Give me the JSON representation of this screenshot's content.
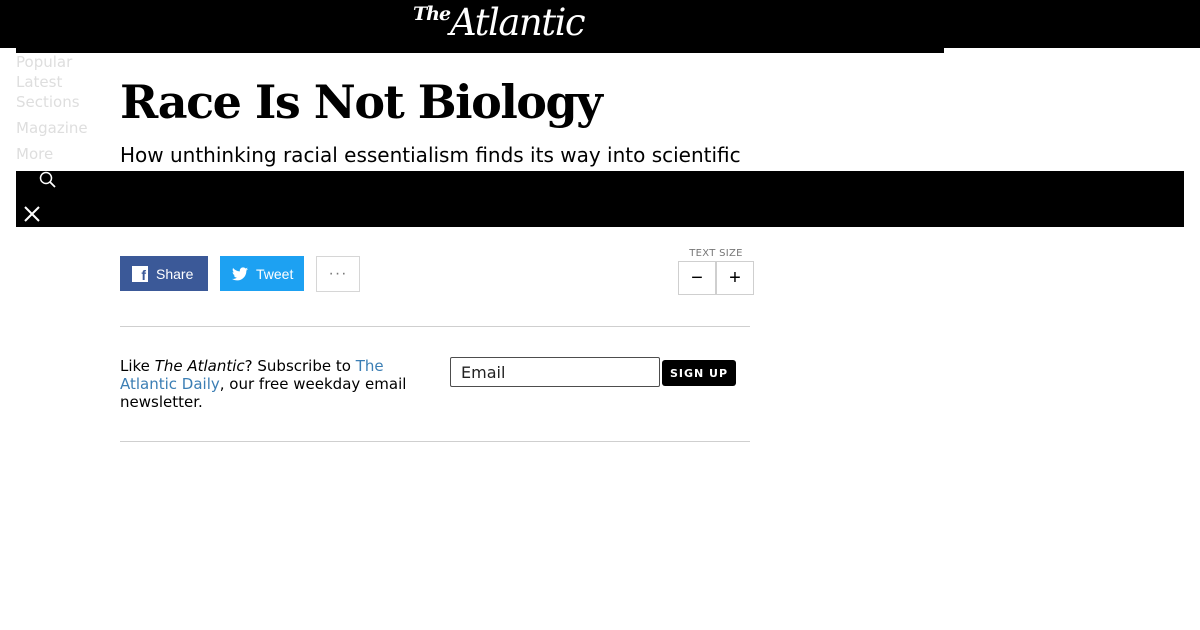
{
  "header": {
    "logo_the": "The",
    "logo_name": "Atlantic",
    "nav": [
      "Popular",
      "Latest",
      "Sections",
      "Magazine",
      "More"
    ]
  },
  "article": {
    "title": "Race Is Not Biology",
    "subtitle": "How unthinking racial essentialism finds its way into scientific"
  },
  "overlay": {
    "icons": [
      "search-icon",
      "close-icon"
    ]
  },
  "share": {
    "facebook_icon": "f",
    "share_label": "Share",
    "tweet_label": "Tweet",
    "more_label": "···"
  },
  "text_size": {
    "label": "TEXT SIZE",
    "decrease": "−",
    "increase": "+"
  },
  "newsletter": {
    "text_prefix": "Like ",
    "text_italic": "The Atlantic",
    "text_mid": "? Subscribe to ",
    "link_text": "The Atlantic Daily",
    "text_suffix": ", our free weekday email newsletter.",
    "email_placeholder": "Email",
    "signup_label": "SIGN UP"
  },
  "colors": {
    "facebook": "#3b5998",
    "twitter": "#1da1f2",
    "link": "#3b7eb4",
    "bar": "#000000"
  }
}
